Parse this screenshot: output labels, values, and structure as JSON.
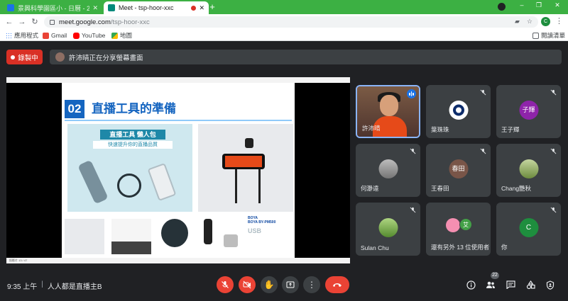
{
  "browser": {
    "tabs": [
      {
        "label": "景興科學園區小 - 日曆 - 2021年...",
        "favicon_color": "#1a73e8",
        "active": false
      },
      {
        "label": "Meet - tsp-hoor-xxc",
        "favicon_color": "#00897b",
        "active": true
      }
    ],
    "new_tab": "+",
    "url_host": "meet.google.com",
    "url_path": "/tsp-hoor-xxc",
    "profile_initial": "C",
    "bookmarks": [
      {
        "label": "應用程式",
        "icon": "apps-grid-icon"
      },
      {
        "label": "Gmail",
        "icon": "gmail-icon"
      },
      {
        "label": "YouTube",
        "icon": "youtube-icon"
      },
      {
        "label": "地圖",
        "icon": "maps-icon"
      }
    ],
    "reading_list": "閱讀清單"
  },
  "meet": {
    "recording_label": "錄製中",
    "presenting_text": "許沛晴正在分享螢幕畫面",
    "slide": {
      "number": "02",
      "title": "直播工具的準備",
      "panel_heading": "直播工具 懶人包",
      "panel_sub": "快速提升你的直播品質",
      "brand": "BOYA",
      "brand_model": "BOYA BY-PM500",
      "usb_text": "USB",
      "status_text": "投影片 13 / 47"
    },
    "participants": [
      {
        "name": "許沛晴",
        "type": "video",
        "speaking": true
      },
      {
        "name": "葉珠珠",
        "type": "avatar",
        "avatar_text": "",
        "avatar_color": "#ffffff"
      },
      {
        "name": "王子輝",
        "type": "avatar",
        "avatar_text": "子輝",
        "avatar_color": "#8e24aa"
      },
      {
        "name": "何瀞遠",
        "type": "avatar",
        "avatar_text": "",
        "avatar_color": "#9e9e9e"
      },
      {
        "name": "王春田",
        "type": "avatar",
        "avatar_text": "春田",
        "avatar_color": "#795548"
      },
      {
        "name": "Chang艷秋",
        "type": "avatar",
        "avatar_text": "",
        "avatar_color": "#8d9e6b"
      },
      {
        "name": "Sulan Chu",
        "type": "avatar",
        "avatar_text": "",
        "avatar_color": "#7cb342"
      },
      {
        "name": "還有另外 13 位使用者",
        "type": "others",
        "avatar_text": "艾",
        "avatar_color": "#43a047"
      },
      {
        "name": "你",
        "type": "avatar",
        "avatar_text": "C",
        "avatar_color": "#1e8e3e"
      }
    ],
    "time": "9:35 上午",
    "separator": "|",
    "meeting_name": "人人都是直播主B",
    "participant_count": "22",
    "colors": {
      "danger": "#ea4335",
      "accent": "#8ab4f8",
      "surface": "#3c4043",
      "background": "#202124"
    }
  }
}
